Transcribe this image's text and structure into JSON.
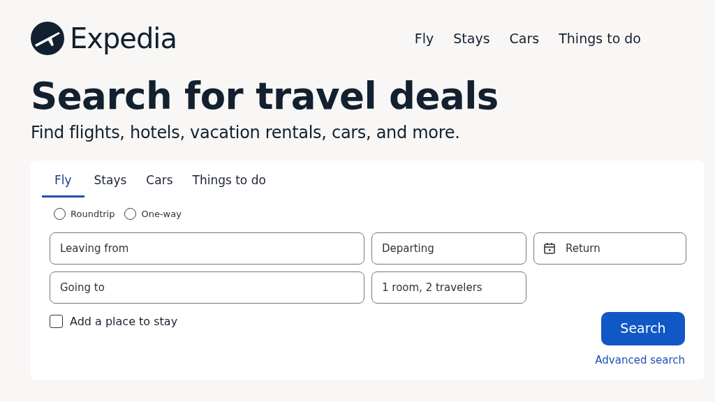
{
  "brand": {
    "name": "Expedia"
  },
  "top_nav": [
    {
      "label": "Fly"
    },
    {
      "label": "Stays"
    },
    {
      "label": "Cars"
    },
    {
      "label": "Things to do"
    }
  ],
  "hero": {
    "title": "Search for travel deals",
    "subtitle": "Find flights, hotels, vacation rentals, cars, and more."
  },
  "tabs": [
    {
      "label": "Fly",
      "selected": true
    },
    {
      "label": "Stays",
      "selected": false
    },
    {
      "label": "Cars",
      "selected": false
    },
    {
      "label": "Things to do",
      "selected": false
    }
  ],
  "trip_types": [
    {
      "label": "Roundtrip",
      "selected": false
    },
    {
      "label": "One-way",
      "selected": false
    }
  ],
  "fields": [
    {
      "placeholder": "Leaving from",
      "kind": "plain"
    },
    {
      "placeholder": "Departing",
      "kind": "plain"
    },
    {
      "placeholder": "Return",
      "kind": "calendar"
    },
    {
      "placeholder": "Going to",
      "kind": "plain"
    },
    {
      "placeholder": "1 room, 2 travelers",
      "kind": "plain"
    }
  ],
  "add_stay": {
    "label": "Add a place to stay",
    "checked": false
  },
  "search_button": "Search",
  "advanced_link": "Advanced search"
}
